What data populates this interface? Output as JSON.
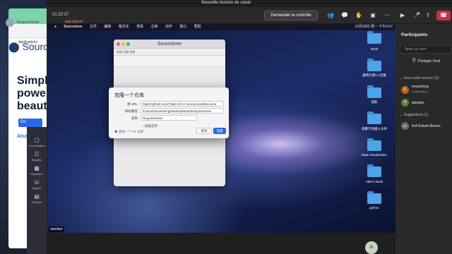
{
  "meeting": {
    "title": "Nouvelle réunion de canal",
    "timer": "01:32:37",
    "present_button": "Demander le contrôle"
  },
  "browser": {
    "bookmarks_label": "Applications",
    "brand": "Sourcetre",
    "headline_1": "Simplic",
    "headline_2": "power",
    "headline_3": "beautif",
    "cta": "Do",
    "also": "Also"
  },
  "teams_rail": {
    "items": [
      {
        "label": "Conversation",
        "icon": "chat-icon"
      },
      {
        "label": "Équipes",
        "icon": "teams-icon"
      },
      {
        "label": "Réunions",
        "icon": "calendar-icon"
      },
      {
        "label": "Appels",
        "icon": "phone-icon"
      },
      {
        "label": "Fichiers",
        "icon": "files-icon"
      }
    ]
  },
  "mac": {
    "menu": [
      "Sourcetree",
      "文件",
      "编辑",
      "格式化",
      "查看",
      "仓库",
      "动作",
      "窗口",
      "帮助"
    ],
    "clock": "12月28日 周一 下午5:07"
  },
  "sourcetree": {
    "title": "Sourcetree",
    "tabs": "本地  远端  克隆",
    "repo_name": "Requirements",
    "hint": "新建/克隆仓库..."
  },
  "clone_dialog": {
    "title": "克隆一个仓库",
    "source_label": "源 URL:",
    "source_value": "https://github.com/Triple-M-A-I-incorporated/docume",
    "path_label": "目标路径:",
    "path_value": "/Users/zhoushining/Desktop/Work/Requirements",
    "name_label": "名称:",
    "name_value": "Requirements",
    "advanced": "高级选项",
    "local_repo": "选择一个 Git 仓库",
    "cancel": "取消",
    "clone": "克隆"
  },
  "desktop_icons": [
    {
      "label": "Work"
    },
    {
      "label": "晨明大捷1-4全集"
    },
    {
      "label": "电影"
    },
    {
      "label": "雨雾宁的输入文件"
    },
    {
      "label": "Data Visualization"
    },
    {
      "label": "Allen's Work"
    },
    {
      "label": "python"
    }
  ],
  "presenter": "alantian",
  "bottom_avatar": "A",
  "participants": {
    "title": "Participants",
    "search_placeholder": "Tapez un nom",
    "share_link": "Partager l'invit",
    "in_meeting_label": "Dans cette réunion (2)",
    "people": [
      {
        "initial": "E",
        "name": "ernecheng",
        "role": "Organisateur",
        "color": "#b5651d"
      },
      {
        "initial": "A",
        "name": "alantian",
        "role": "",
        "color": "#5b7f3a"
      }
    ],
    "suggestions_label": "Suggestions (1)",
    "suggestions": [
      {
        "initial": "KE",
        "name": "Kofi Edwini-Bonsu",
        "color": "#6b6b6b"
      }
    ]
  }
}
